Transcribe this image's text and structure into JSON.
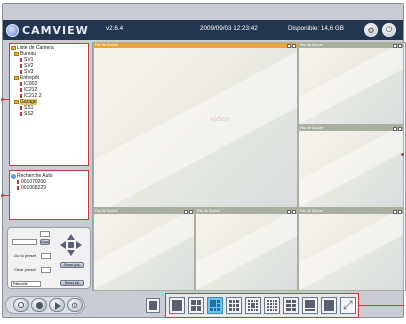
{
  "header": {
    "app_name": "CAMVIEW",
    "version": "v2.6.4",
    "datetime": "2009/09/03 12:23:42",
    "disk": "Disponible: 14,6 GB"
  },
  "camera_list": {
    "root": "Liste de Camera",
    "groups": [
      {
        "label": "Bureau",
        "items": [
          "SV1",
          "SV2",
          "SV3"
        ]
      },
      {
        "label": "Entrepôt",
        "items": [
          "IC802",
          "IC212",
          "IC212.2"
        ]
      },
      {
        "label": "Garage",
        "items": [
          "SS1",
          "SS2"
        ]
      }
    ]
  },
  "auto_search": {
    "root": "Recherche Auto",
    "items": [
      "001070200",
      "001068229"
    ]
  },
  "ptz": {
    "speed_field": "",
    "go_label": "Gost",
    "preset_go": "Go to preset",
    "preset_clear": "Clear preset",
    "patrol": "Patrouille",
    "btn_set_preset": "Reset pos",
    "btn_reset": "Reset init"
  },
  "viewer": {
    "cell_title": "Pas de Source",
    "watermark": "video"
  },
  "colors": {
    "header_bg": "#23364f",
    "accent_red": "#c83b3b",
    "active_cell": "#e9a53a",
    "active_layout": "#6fc3ee"
  },
  "bottom_icons": [
    "search-icon",
    "record-icon",
    "playback-icon",
    "settings-icon"
  ],
  "layout_buttons": [
    "layout-1",
    "layout-4",
    "layout-6",
    "layout-9",
    "layout-13",
    "layout-16",
    "layout-25",
    "layout-36",
    "layout-single",
    "layout-single-alt",
    "fullscreen"
  ]
}
